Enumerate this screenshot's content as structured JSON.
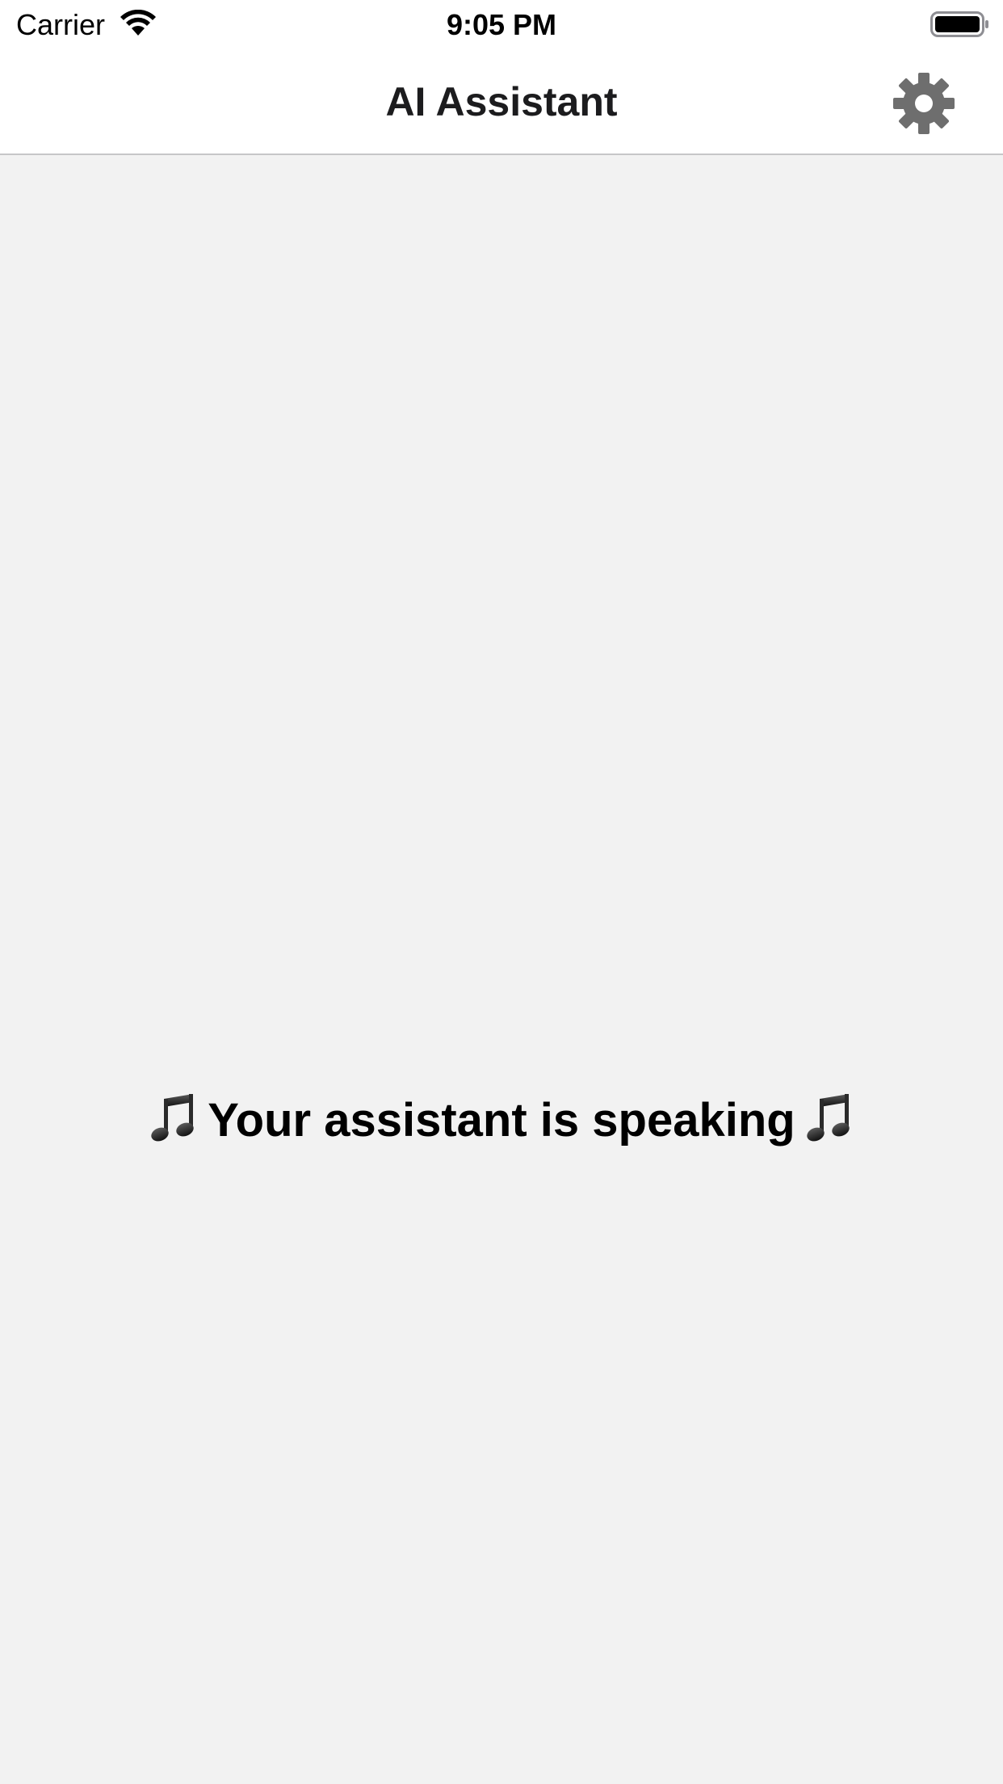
{
  "status_bar": {
    "carrier": "Carrier",
    "time": "9:05 PM",
    "wifi_icon": "wifi-icon",
    "battery_icon": "battery-icon"
  },
  "nav": {
    "title": "AI Assistant",
    "settings_icon": "gear-icon"
  },
  "content": {
    "message": "Your assistant is speaking",
    "decoration_icon": "music-note-icon"
  },
  "colors": {
    "background": "#f2f2f2",
    "bar_background": "#ffffff",
    "gear": "#6e6e6e",
    "separator": "#c6c6c8"
  }
}
